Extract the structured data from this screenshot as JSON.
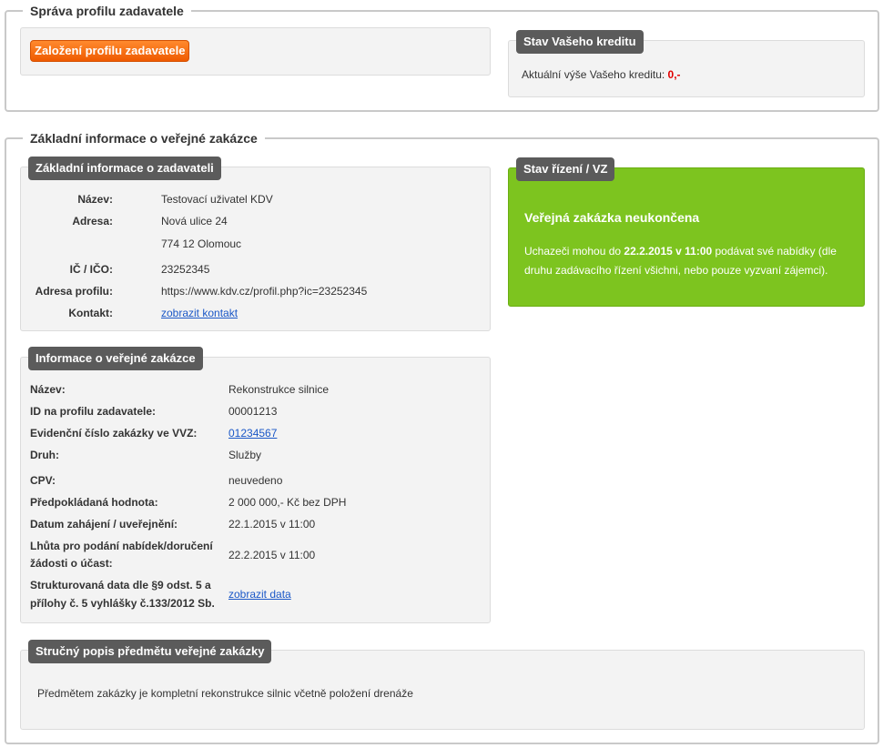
{
  "management": {
    "legend": "Správa profilu zadavatele",
    "create_button": "Založení profilu zadavatele",
    "credit": {
      "title": "Stav Vašeho kreditu",
      "label": "Aktuální výše Vašeho kreditu:",
      "value": "0,-"
    }
  },
  "basic": {
    "legend": "Základní informace o veřejné zakázce",
    "contracting": {
      "title": "Základní informace o zadavateli",
      "name_label": "Název:",
      "name_value": "Testovací uživatel KDV",
      "address_label": "Adresa:",
      "address_line1": "Nová ulice 24",
      "address_line2": "774 12 Olomouc",
      "ic_label": "IČ / IČO:",
      "ic_value": "23252345",
      "profile_label": "Adresa profilu:",
      "profile_value": "https://www.kdv.cz/profil.php?ic=23252345",
      "contact_label": "Kontakt:",
      "contact_link": "zobrazit kontakt"
    },
    "status": {
      "title": "Stav řízení / VZ",
      "headline": "Veřejná zakázka neukončena",
      "text_before": "Uchazeči mohou do ",
      "text_date": "22.2.2015 v 11:00",
      "text_after": " podávat své nabídky (dle druhu zadávacího řízení všichni, nebo pouze vyzvaní zájemci)."
    },
    "contract": {
      "title": "Informace o veřejné zakázce",
      "rows": {
        "name_label": "Název:",
        "name_value": "Rekonstrukce silnice",
        "id_label": "ID na profilu zadavatele:",
        "id_value": "00001213",
        "evid_label": "Evidenční číslo zakázky ve VVZ:",
        "evid_value": "01234567",
        "type_label": "Druh:",
        "type_value": "Služby",
        "cpv_label": "CPV:",
        "cpv_value": "neuvedeno",
        "est_label": "Předpokládaná hodnota:",
        "est_value": "2 000 000,- Kč bez DPH",
        "start_label": "Datum zahájení / uveřejnění:",
        "start_value": "22.1.2015 v 11:00",
        "deadline_label_1": "Lhůta pro podání nabídek/doručení",
        "deadline_label_2": "žádosti o účast:",
        "deadline_value": "22.2.2015 v 11:00",
        "struct_label_1": "Strukturovaná data dle §9 odst. 5 a",
        "struct_label_2": "přílohy č. 5 vyhlášky č.133/2012 Sb.",
        "struct_link": "zobrazit data"
      }
    },
    "description": {
      "title": "Stručný popis předmětu veřejné zakázky",
      "text": "Předmětem zakázky je kompletní rekonstrukce silnic včetně položení drenáže"
    }
  }
}
